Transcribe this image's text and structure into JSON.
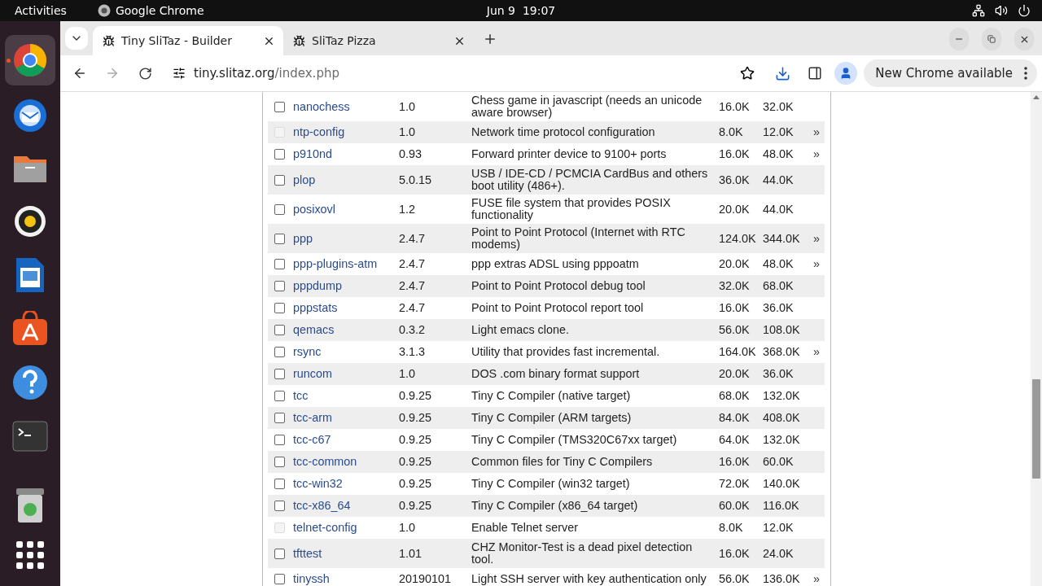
{
  "top_bar": {
    "activities": "Activities",
    "app_name": "Google Chrome",
    "clock": "Jun 9  19:07"
  },
  "browser": {
    "tabs": [
      {
        "title": "Tiny SliTaz - Builder",
        "selected": true
      },
      {
        "title": "SliTaz Pizza",
        "selected": false
      }
    ],
    "address": {
      "host": "tiny.slitaz.org",
      "path": "/index.php"
    },
    "update_button": "New Chrome available"
  },
  "packages": [
    {
      "name": "nanochess",
      "version": "1.0",
      "description": "Chess game in javascript (needs an unicode aware browser)",
      "size": "16.0K",
      "installed_size": "32.0K",
      "checked": false,
      "disabled": false
    },
    {
      "name": "ntp-config",
      "version": "1.0",
      "description": "Network time protocol configuration",
      "size": "8.0K",
      "installed_size": "12.0K",
      "more": "»",
      "checked": false,
      "disabled": true
    },
    {
      "name": "p910nd",
      "version": "0.93",
      "description": "Forward printer device to 9100+ ports",
      "size": "16.0K",
      "installed_size": "48.0K",
      "more": "»",
      "checked": false,
      "disabled": false
    },
    {
      "name": "plop",
      "version": "5.0.15",
      "description": "USB / IDE-CD / PCMCIA CardBus and others boot utility (486+).",
      "size": "36.0K",
      "installed_size": "44.0K",
      "checked": false,
      "disabled": false
    },
    {
      "name": "posixovl",
      "version": "1.2",
      "description": "FUSE file system that provides POSIX functionality",
      "size": "20.0K",
      "installed_size": "44.0K",
      "checked": false,
      "disabled": false
    },
    {
      "name": "ppp",
      "version": "2.4.7",
      "description": "Point to Point Protocol (Internet with RTC modems)",
      "size": "124.0K",
      "installed_size": "344.0K",
      "more": "»",
      "checked": false,
      "disabled": false
    },
    {
      "name": "ppp-plugins-atm",
      "version": "2.4.7",
      "description": "ppp extras ADSL using pppoatm",
      "size": "20.0K",
      "installed_size": "48.0K",
      "more": "»",
      "checked": false,
      "disabled": false
    },
    {
      "name": "pppdump",
      "version": "2.4.7",
      "description": "Point to Point Protocol debug tool",
      "size": "32.0K",
      "installed_size": "68.0K",
      "checked": false,
      "disabled": false
    },
    {
      "name": "pppstats",
      "version": "2.4.7",
      "description": "Point to Point Protocol report tool",
      "size": "16.0K",
      "installed_size": "36.0K",
      "checked": false,
      "disabled": false
    },
    {
      "name": "qemacs",
      "version": "0.3.2",
      "description": "Light emacs clone.",
      "size": "56.0K",
      "installed_size": "108.0K",
      "checked": false,
      "disabled": false
    },
    {
      "name": "rsync",
      "version": "3.1.3",
      "description": "Utility that provides fast incremental.",
      "size": "164.0K",
      "installed_size": "368.0K",
      "more": "»",
      "checked": false,
      "disabled": false
    },
    {
      "name": "runcom",
      "version": "1.0",
      "description": "DOS .com binary format support",
      "size": "20.0K",
      "installed_size": "36.0K",
      "checked": false,
      "disabled": false
    },
    {
      "name": "tcc",
      "version": "0.9.25",
      "description": "Tiny C Compiler (native target)",
      "size": "68.0K",
      "installed_size": "132.0K",
      "checked": false,
      "disabled": false
    },
    {
      "name": "tcc-arm",
      "version": "0.9.25",
      "description": "Tiny C Compiler (ARM targets)",
      "size": "84.0K",
      "installed_size": "408.0K",
      "checked": false,
      "disabled": false
    },
    {
      "name": "tcc-c67",
      "version": "0.9.25",
      "description": "Tiny C Compiler (TMS320C67xx target)",
      "size": "64.0K",
      "installed_size": "132.0K",
      "checked": false,
      "disabled": false
    },
    {
      "name": "tcc-common",
      "version": "0.9.25",
      "description": "Common files for Tiny C Compilers",
      "size": "16.0K",
      "installed_size": "60.0K",
      "checked": false,
      "disabled": false
    },
    {
      "name": "tcc-win32",
      "version": "0.9.25",
      "description": "Tiny C Compiler (win32 target)",
      "size": "72.0K",
      "installed_size": "140.0K",
      "checked": false,
      "disabled": false
    },
    {
      "name": "tcc-x86_64",
      "version": "0.9.25",
      "description": "Tiny C Compiler (x86_64 target)",
      "size": "60.0K",
      "installed_size": "116.0K",
      "checked": false,
      "disabled": false
    },
    {
      "name": "telnet-config",
      "version": "1.0",
      "description": "Enable Telnet server",
      "size": "8.0K",
      "installed_size": "12.0K",
      "checked": false,
      "disabled": true
    },
    {
      "name": "tfttest",
      "version": "1.01",
      "description": "CHZ Monitor-Test is a dead pixel detection tool.",
      "size": "16.0K",
      "installed_size": "24.0K",
      "checked": false,
      "disabled": false
    },
    {
      "name": "tinyssh",
      "version": "20190101",
      "description": "Light SSH server with key authentication only",
      "size": "56.0K",
      "installed_size": "136.0K",
      "more": "»",
      "checked": false,
      "disabled": false
    }
  ]
}
